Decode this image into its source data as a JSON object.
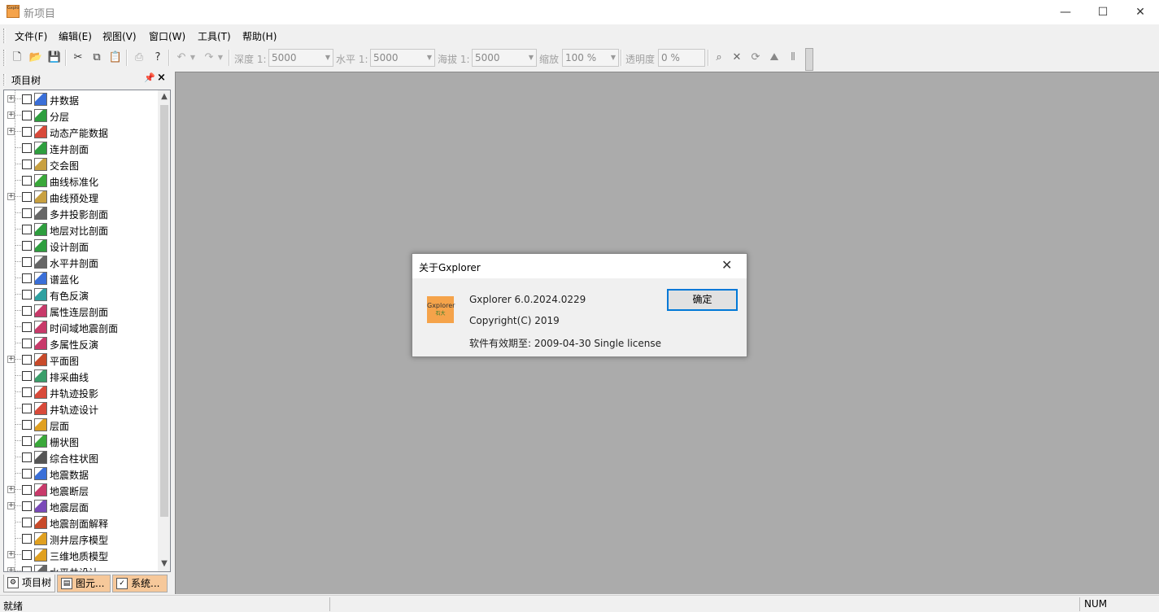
{
  "window": {
    "title": "新项目",
    "app_icon_text": "Gxplorer",
    "controls": {
      "minimize": "—",
      "maximize": "☐",
      "close": "✕"
    }
  },
  "menu": [
    "文件(F)",
    "编辑(E)",
    "视图(V)",
    "窗口(W)",
    "工具(T)",
    "帮助(H)"
  ],
  "toolbar": {
    "depth_label": "深度 1:",
    "depth_value": "5000",
    "horizontal_label": "水平 1:",
    "horizontal_value": "5000",
    "altitude_label": "海拔 1:",
    "altitude_value": "5000",
    "zoom_label": "缩放",
    "zoom_value": "100 %",
    "opacity_label": "透明度",
    "opacity_value": "0 %"
  },
  "tree_panel": {
    "title": "项目树",
    "items": [
      {
        "label": "井数据",
        "expandable": true,
        "color": "#3a6fd8"
      },
      {
        "label": "分层",
        "expandable": true,
        "color": "#2e9e3e"
      },
      {
        "label": "动态产能数据",
        "expandable": true,
        "color": "#d84a3a"
      },
      {
        "label": "连井剖面",
        "expandable": false,
        "color": "#2e9e3e"
      },
      {
        "label": "交会图",
        "expandable": false,
        "color": "#c8a040"
      },
      {
        "label": "曲线标准化",
        "expandable": false,
        "color": "#3aa83a"
      },
      {
        "label": "曲线预处理",
        "expandable": true,
        "color": "#c8a040"
      },
      {
        "label": "多井投影剖面",
        "expandable": false,
        "color": "#666666"
      },
      {
        "label": "地层对比剖面",
        "expandable": false,
        "color": "#2e9e3e"
      },
      {
        "label": "设计剖面",
        "expandable": false,
        "color": "#2e9e3e"
      },
      {
        "label": "水平井剖面",
        "expandable": false,
        "color": "#666666"
      },
      {
        "label": "谱蓝化",
        "expandable": false,
        "color": "#3a6fd8"
      },
      {
        "label": "有色反演",
        "expandable": false,
        "color": "#2ea0a0"
      },
      {
        "label": "属性连层剖面",
        "expandable": false,
        "color": "#c83a6a"
      },
      {
        "label": "时间域地震剖面",
        "expandable": false,
        "color": "#c83a6a"
      },
      {
        "label": "多属性反演",
        "expandable": false,
        "color": "#c83a6a"
      },
      {
        "label": "平面图",
        "expandable": true,
        "color": "#c84a2a"
      },
      {
        "label": "排采曲线",
        "expandable": false,
        "color": "#3a9e6a"
      },
      {
        "label": "井轨迹投影",
        "expandable": false,
        "color": "#d84a3a"
      },
      {
        "label": "井轨迹设计",
        "expandable": false,
        "color": "#d84a3a"
      },
      {
        "label": "层面",
        "expandable": false,
        "color": "#e0a020"
      },
      {
        "label": "栅状图",
        "expandable": false,
        "color": "#3aa83a"
      },
      {
        "label": "综合柱状图",
        "expandable": false,
        "color": "#555555"
      },
      {
        "label": "地震数据",
        "expandable": false,
        "color": "#3a6fd8"
      },
      {
        "label": "地震断层",
        "expandable": true,
        "color": "#c83a6a"
      },
      {
        "label": "地震层面",
        "expandable": true,
        "color": "#7a4ab8"
      },
      {
        "label": "地震剖面解释",
        "expandable": false,
        "color": "#c84a2a"
      },
      {
        "label": "测井层序模型",
        "expandable": false,
        "color": "#e0a020"
      },
      {
        "label": "三维地质模型",
        "expandable": true,
        "color": "#e0a020"
      },
      {
        "label": "水平井设计",
        "expandable": true,
        "color": "#666666"
      }
    ]
  },
  "tabs": [
    "项目树",
    "图元...",
    "系统..."
  ],
  "status": {
    "text": "就绪",
    "num": "NUM"
  },
  "dialog": {
    "title": "关于Gxplorer",
    "logo_text": "Gxplorer",
    "logo_sub": "石大",
    "version": "Gxplorer 6.0.2024.0229",
    "copyright": "Copyright(C) 2019",
    "license": "软件有效期至: 2009-04-30 Single license",
    "ok_label": "确定"
  }
}
